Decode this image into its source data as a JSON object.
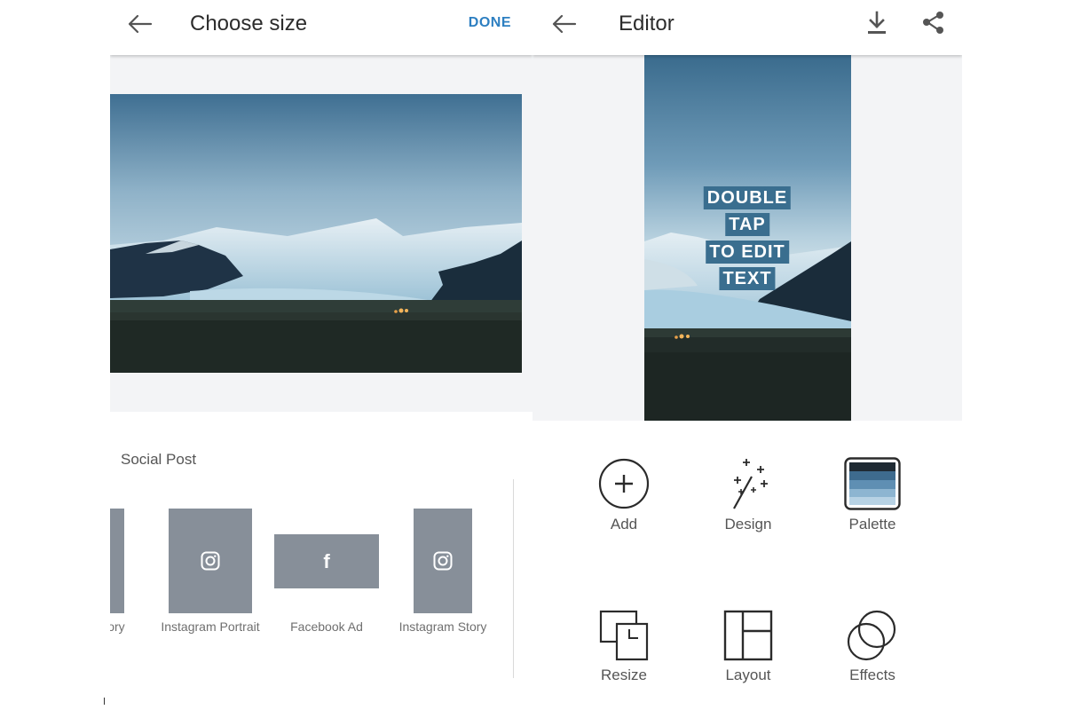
{
  "left_screen": {
    "title": "Choose size",
    "done_label": "DONE",
    "section_label": "Social Post",
    "sizes": [
      {
        "label": "Story",
        "icon": "instagram-icon"
      },
      {
        "label": "Instagram Portrait",
        "icon": "instagram-icon"
      },
      {
        "label": "Facebook Ad",
        "icon": "facebook-icon"
      },
      {
        "label": "Instagram Story",
        "icon": "instagram-icon"
      }
    ]
  },
  "right_screen": {
    "title": "Editor",
    "toolbar_icons": [
      "download-icon",
      "share-icon"
    ],
    "overlay_text": [
      "DOUBLE",
      "TAP",
      "TO EDIT",
      "TEXT"
    ],
    "tools": [
      {
        "label": "Add",
        "icon": "plus-circle-icon"
      },
      {
        "label": "Design",
        "icon": "magic-wand-icon"
      },
      {
        "label": "Palette",
        "icon": "palette-icon"
      },
      {
        "label": "Resize",
        "icon": "resize-icon"
      },
      {
        "label": "Layout",
        "icon": "layout-icon"
      },
      {
        "label": "Effects",
        "icon": "effects-icon"
      }
    ]
  },
  "colors": {
    "accent": "#2d7fc1",
    "thumb_gray": "#878f99",
    "text_overlay_bg": "#3a6e8f",
    "preview_bg": "#f3f4f6"
  }
}
